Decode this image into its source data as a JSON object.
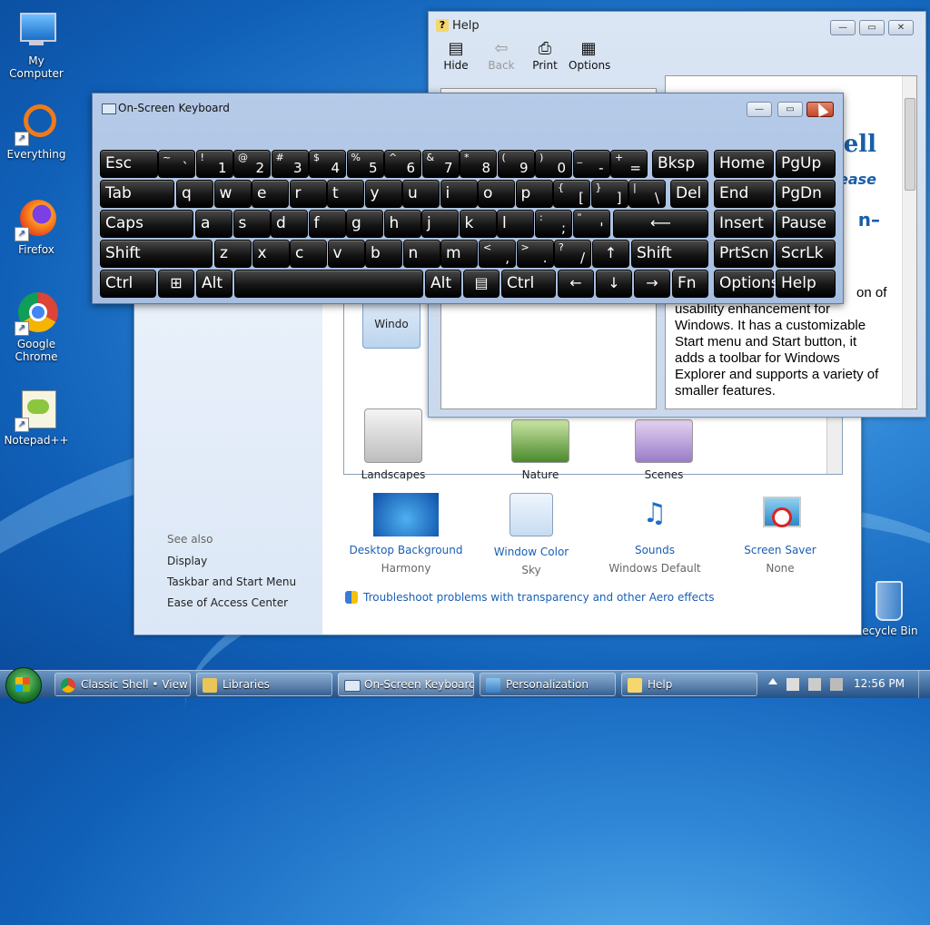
{
  "desktop": {
    "icons": [
      {
        "label": "My Computer",
        "icon": "computer-icon"
      },
      {
        "label": "Everything",
        "icon": "everything-icon"
      },
      {
        "label": "Firefox",
        "icon": "firefox-icon"
      },
      {
        "label": "Google Chrome",
        "icon": "chrome-icon"
      },
      {
        "label": "Notepad++",
        "icon": "notepadpp-icon"
      },
      {
        "label": "Recycle Bin",
        "icon": "recycle-bin-icon"
      }
    ]
  },
  "personalization": {
    "see_also": "See also",
    "links": [
      "Display",
      "Taskbar and Start Menu",
      "Ease of Access Center"
    ],
    "themes": [
      {
        "label": "Windo"
      },
      {
        "label": "Landscapes"
      },
      {
        "label": "Nature"
      },
      {
        "label": "Scenes"
      }
    ],
    "bottom": [
      {
        "link": "Desktop Background",
        "value": "Harmony"
      },
      {
        "link": "Window Color",
        "value": "Sky"
      },
      {
        "link": "Sounds",
        "value": "Windows Default"
      },
      {
        "link": "Screen Saver",
        "value": "None"
      }
    ],
    "troubleshoot": "Troubleshoot problems with transparency and other Aero effects"
  },
  "help": {
    "title": "Help",
    "toolbar": [
      "Hide",
      "Back",
      "Print",
      "Options"
    ],
    "heading": "hell",
    "subheading": "elease",
    "dash": "n–",
    "body": "on of usability enhancement for Windows. It has a customizable Start menu and Start button, it adds a toolbar for Windows Explorer and supports a variety of smaller features."
  },
  "osk": {
    "title": "On-Screen Keyboard",
    "keys": {
      "esc": "Esc",
      "tab": "Tab",
      "caps": "Caps",
      "shift": "Shift",
      "ctrl": "Ctrl",
      "alt": "Alt",
      "bksp": "Bksp",
      "del": "Del",
      "home": "Home",
      "pgup": "PgUp",
      "end": "End",
      "pgdn": "PgDn",
      "insert": "Insert",
      "pause": "Pause",
      "prtscn": "PrtScn",
      "scrlk": "ScrLk",
      "options": "Options",
      "help": "Help",
      "fn": "Fn"
    },
    "row1": [
      [
        "~",
        "`"
      ],
      [
        "!",
        "1"
      ],
      [
        "@",
        "2"
      ],
      [
        "#",
        "3"
      ],
      [
        "$",
        "4"
      ],
      [
        "%",
        "5"
      ],
      [
        "^",
        "6"
      ],
      [
        "&",
        "7"
      ],
      [
        "*",
        "8"
      ],
      [
        "(",
        "9"
      ],
      [
        ")",
        "0"
      ],
      [
        "_",
        "-"
      ],
      [
        "+",
        "="
      ]
    ],
    "row2": [
      "q",
      "w",
      "e",
      "r",
      "t",
      "y",
      "u",
      "i",
      "o",
      "p"
    ],
    "row2_extra": [
      [
        "{",
        "["
      ],
      [
        "}",
        "]"
      ],
      [
        "|",
        "\\"
      ]
    ],
    "row3": [
      "a",
      "s",
      "d",
      "f",
      "g",
      "h",
      "j",
      "k",
      "l"
    ],
    "row3_extra": [
      [
        ":",
        ";"
      ],
      [
        "\"",
        "'"
      ]
    ],
    "row4": [
      "z",
      "x",
      "c",
      "v",
      "b",
      "n",
      "m"
    ],
    "row4_extra": [
      [
        "<",
        ","
      ],
      [
        ">",
        "."
      ],
      [
        "?",
        "/"
      ]
    ],
    "arrows": {
      "up": "↑",
      "down": "↓",
      "left": "←",
      "right": "→",
      "enter": "⟵"
    }
  },
  "taskbar": {
    "tasks": [
      {
        "label": "Classic Shell • View ...",
        "icon": "chrome-icon"
      },
      {
        "label": "Libraries",
        "icon": "folder-icon"
      },
      {
        "label": "On-Screen Keyboard",
        "icon": "keyboard-icon"
      },
      {
        "label": "Personalization",
        "icon": "personalization-icon"
      },
      {
        "label": "Help",
        "icon": "help-icon"
      }
    ],
    "clock": "12:56 PM"
  }
}
